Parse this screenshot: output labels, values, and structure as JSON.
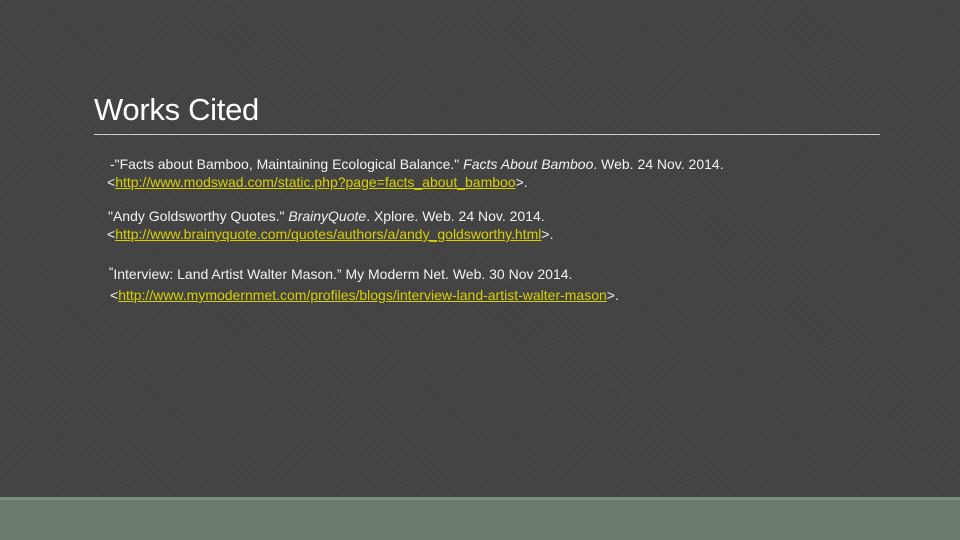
{
  "slide": {
    "title": "Works Cited",
    "citations": [
      {
        "lead": "-\"Facts about Bamboo, Maintaining  Ecological Balance.\" ",
        "source": "Facts About Bamboo",
        "tail": ". Web. 24 Nov. 2014.",
        "url_open": "<",
        "url": "http://www.modswad.com/static.php?page=facts_about_bamboo",
        "url_close": ">."
      },
      {
        "lead": "\"Andy  Goldsworthy Quotes.\" ",
        "source": "BrainyQuote",
        "tail": ". Xplore.  Web. 24 Nov.  2014.",
        "url_open": "<",
        "url": "http://www.brainyquote.com/quotes/authors/a/andy_goldsworthy.html",
        "url_close": ">."
      },
      {
        "quote_mark": "“",
        "lead": "Interview: Land Artist Walter Mason.” My Moderm Net. Web. 30 Nov 2014.",
        "url_open": "<",
        "url": "http://www.mymodernmet.com/profiles/blogs/interview-land-artist-walter-mason",
        "url_close": ">."
      }
    ]
  },
  "colors": {
    "background": "#434343",
    "link": "#d8d000",
    "footer": "#6b7b6e"
  }
}
